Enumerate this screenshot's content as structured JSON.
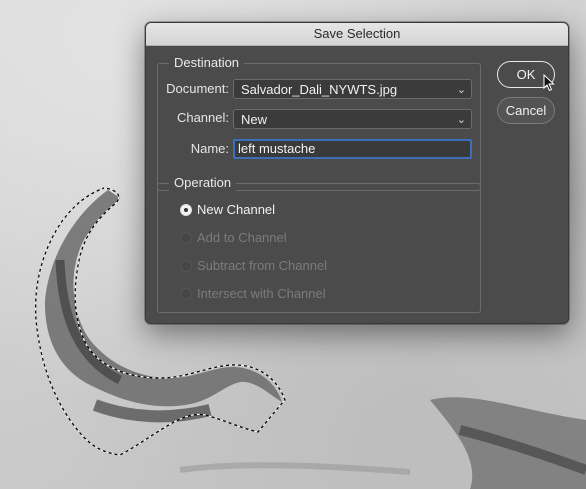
{
  "dialog": {
    "title": "Save Selection",
    "destination": {
      "title": "Destination",
      "document_label": "Document:",
      "document_value": "Salvador_Dali_NYWTS.jpg",
      "channel_label": "Channel:",
      "channel_value": "New",
      "name_label": "Name:",
      "name_value": "left mustache"
    },
    "operation": {
      "title": "Operation",
      "options": [
        {
          "label": "New Channel",
          "selected": true,
          "enabled": true
        },
        {
          "label": "Add to Channel",
          "selected": false,
          "enabled": false
        },
        {
          "label": "Subtract from Channel",
          "selected": false,
          "enabled": false
        },
        {
          "label": "Intersect with Channel",
          "selected": false,
          "enabled": false
        }
      ]
    },
    "buttons": {
      "ok_label": "OK",
      "cancel_label": "Cancel"
    }
  },
  "icons": {
    "dropdown": "chevron-down-icon",
    "pointer": "mouse-pointer-icon"
  }
}
